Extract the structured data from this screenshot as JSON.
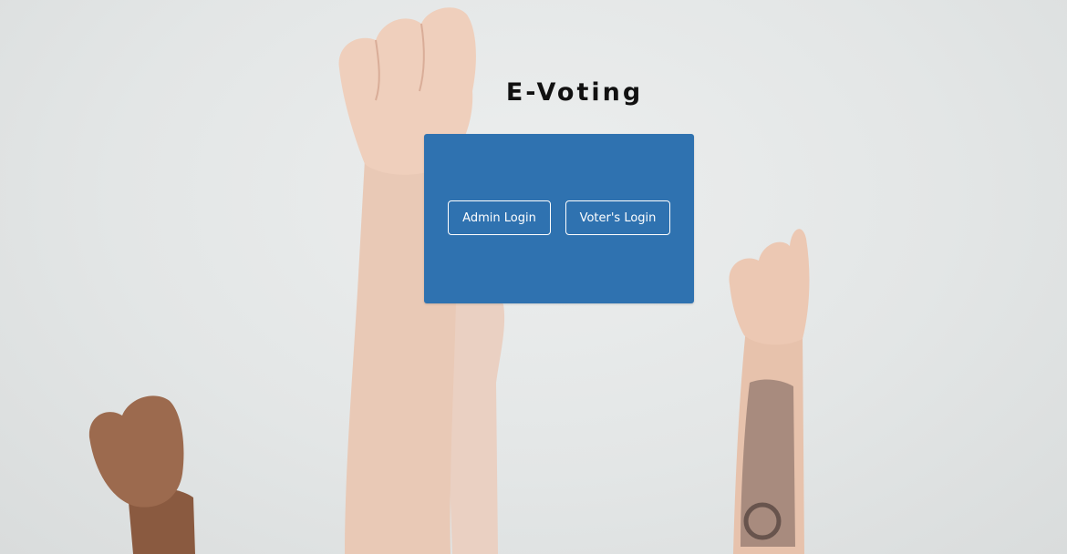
{
  "page": {
    "title": "E-Voting"
  },
  "login_card": {
    "admin_button_label": "Admin Login",
    "voter_button_label": "Voter's Login"
  },
  "colors": {
    "card_background": "#2f72b0",
    "button_border": "#ffffff",
    "page_background": "#e5e7e7"
  }
}
